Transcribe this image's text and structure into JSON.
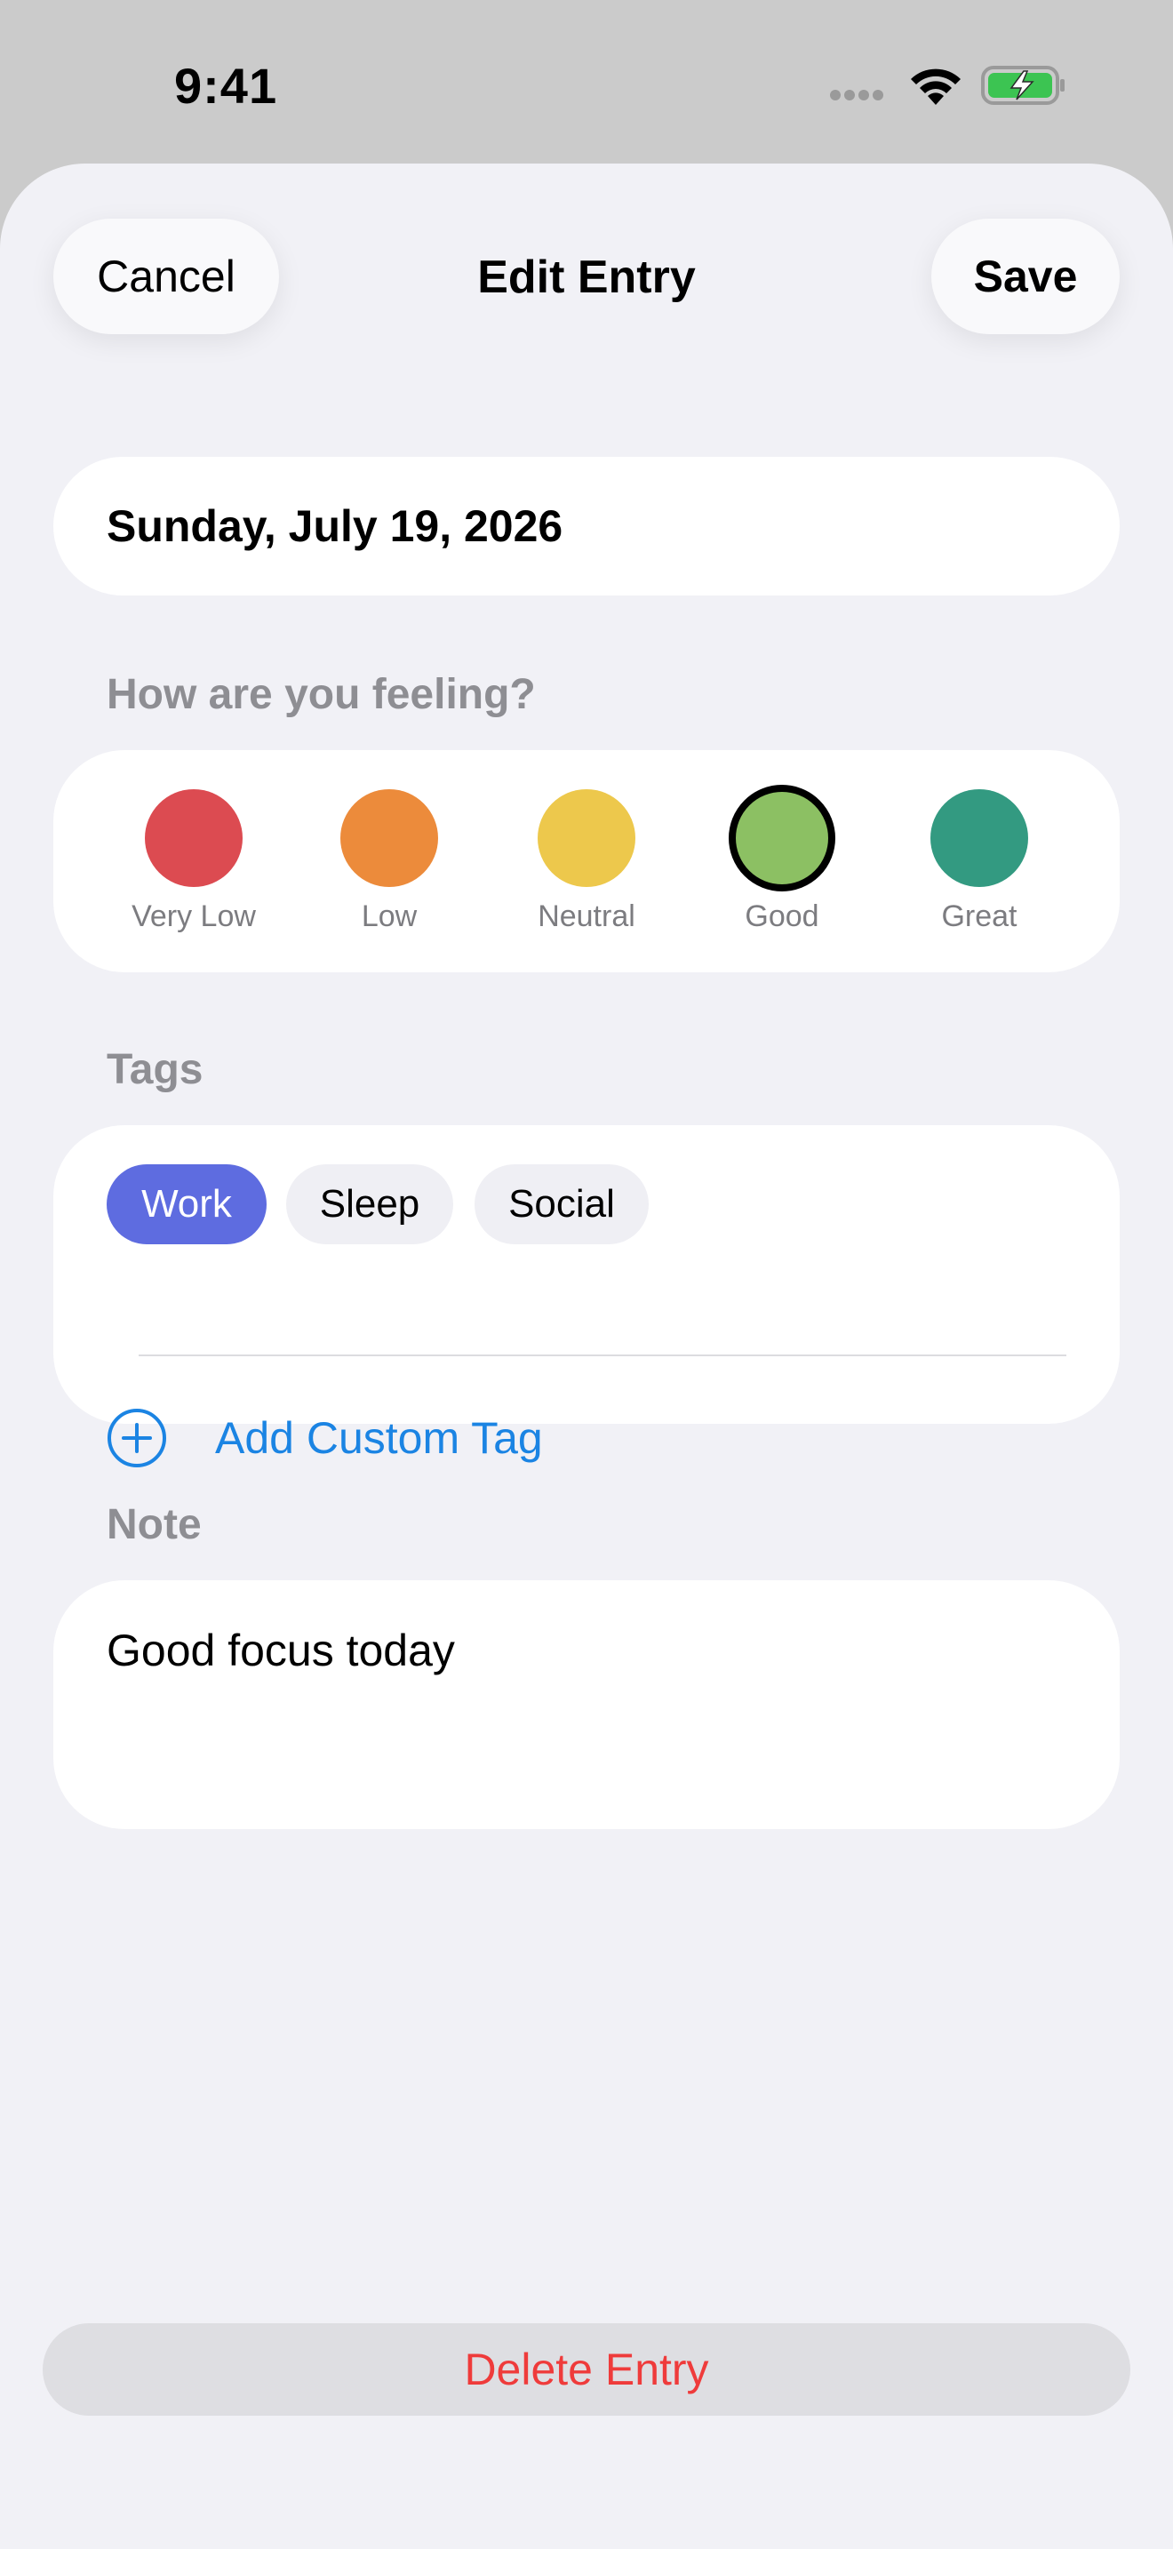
{
  "status_bar": {
    "time": "9:41"
  },
  "header": {
    "cancel_label": "Cancel",
    "title": "Edit Entry",
    "save_label": "Save"
  },
  "entry": {
    "date": "Sunday, July 19, 2026"
  },
  "mood": {
    "section_label": "How are you feeling?",
    "selected": "Good",
    "options": [
      {
        "label": "Very Low",
        "color": "#dc4b51"
      },
      {
        "label": "Low",
        "color": "#ec8b3b"
      },
      {
        "label": "Neutral",
        "color": "#edc84c"
      },
      {
        "label": "Good",
        "color": "#8cc063"
      },
      {
        "label": "Great",
        "color": "#339a81"
      }
    ]
  },
  "tags": {
    "section_label": "Tags",
    "items": [
      {
        "label": "Work",
        "selected": true
      },
      {
        "label": "Sleep",
        "selected": false
      },
      {
        "label": "Social",
        "selected": false
      }
    ],
    "add_label": "Add Custom Tag"
  },
  "note": {
    "section_label": "Note",
    "value": "Good focus today"
  },
  "delete_label": "Delete Entry",
  "colors": {
    "accent": "#1b84e3",
    "tag_selected": "#5e6ce0",
    "destructive": "#ef3b3b",
    "battery": "#3cc452"
  }
}
